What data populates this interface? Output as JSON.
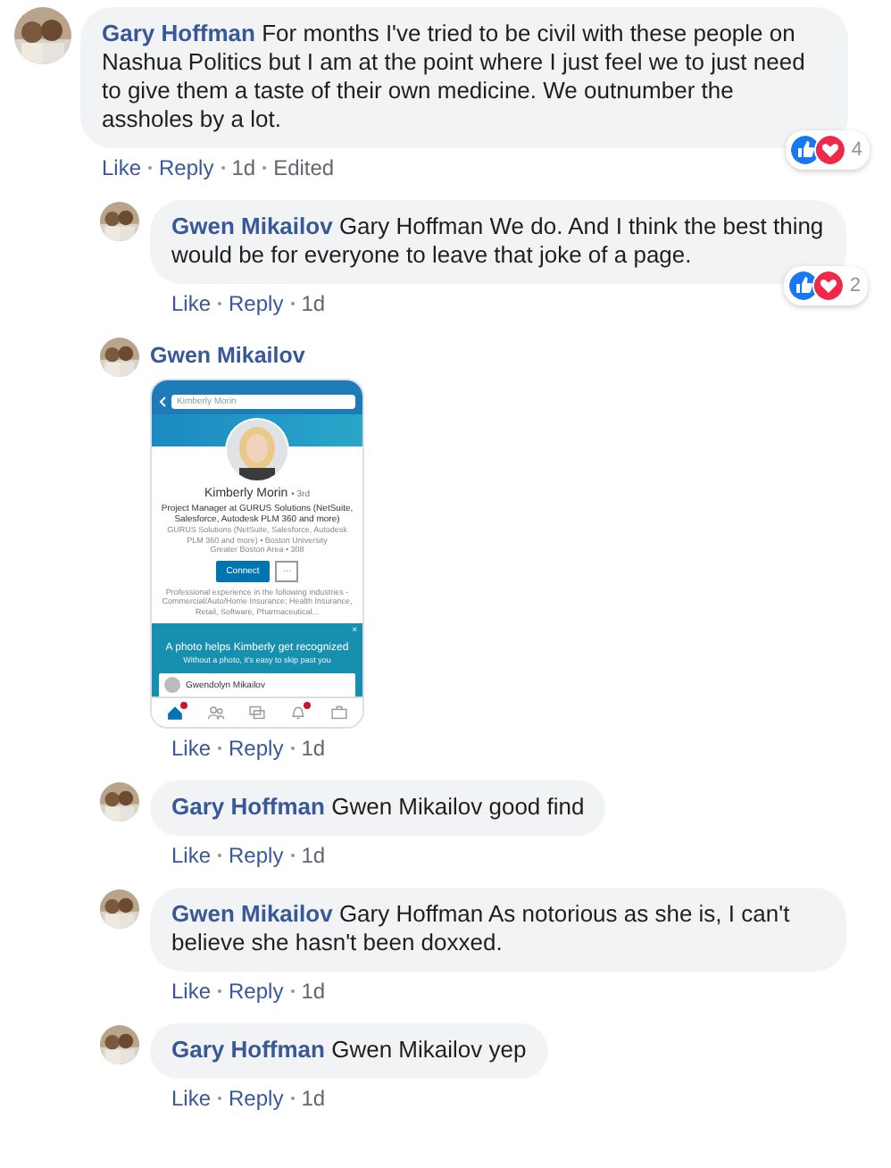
{
  "comments": [
    {
      "author": "Gary Hoffman",
      "text": "For months I've tried to be civil with these people on Nashua Politics but I am at the point where I just feel we to just need to give them a taste of their own medicine. We outnumber the assholes by a lot.",
      "actions": [
        "Like",
        "Reply",
        "1d",
        "Edited"
      ],
      "reactions": {
        "icons": [
          {
            "kind": "like"
          },
          {
            "kind": "love"
          }
        ],
        "count": "4"
      },
      "replies": [
        {
          "author": "Gwen Mikailov",
          "text": "Gary Hoffman We do. And I think the best thing would be for everyone to leave that joke of a page.",
          "actions": [
            "Like",
            "Reply",
            "1d"
          ],
          "reactions": {
            "icons": [
              {
                "kind": "like"
              },
              {
                "kind": "love"
              }
            ],
            "count": "2"
          }
        },
        {
          "author": "Gwen Mikailov",
          "attachment": {
            "kind": "screenshot",
            "search": "Kimberly Morin",
            "name": "Kimberly Morin",
            "degree": "• 3rd",
            "headline": "Project Manager at GURUS Solutions (NetSuite, Salesforce, Autodesk PLM 360 and more)",
            "details": "GURUS Solutions (NetSuite, Salesforce, Autodesk PLM 360 and more) • Boston University",
            "location": "Greater Boston Area • 308",
            "buttons": [
              "Connect",
              "···"
            ],
            "summary": "Professional experience in the following industries - Commercial/Auto/Home Insurance; Health Insurance, Retail, Software, Pharmaceutical...",
            "banner_title": "A photo helps Kimberly get recognized",
            "banner_subtitle": "Without a photo, it's easy to skip past you",
            "banner_close": "×",
            "banner_person": "Gwendolyn Mikailov",
            "nav": [
              {
                "selected": true,
                "badge": true
              },
              {
                "selected": false,
                "badge": false
              },
              {
                "selected": false,
                "badge": false
              },
              {
                "selected": false,
                "badge": true
              },
              {
                "selected": false,
                "badge": false
              }
            ]
          },
          "actions": [
            "Like",
            "Reply",
            "1d"
          ]
        },
        {
          "author": "Gary Hoffman",
          "text": "Gwen Mikailov good find",
          "actions": [
            "Like",
            "Reply",
            "1d"
          ]
        },
        {
          "author": "Gwen Mikailov",
          "text": "Gary Hoffman As notorious as she is, I can't believe she hasn't been doxxed.",
          "actions": [
            "Like",
            "Reply",
            "1d"
          ]
        },
        {
          "author": "Gary Hoffman",
          "text": "Gwen Mikailov yep",
          "actions": [
            "Like",
            "Reply",
            "1d"
          ]
        }
      ]
    }
  ]
}
